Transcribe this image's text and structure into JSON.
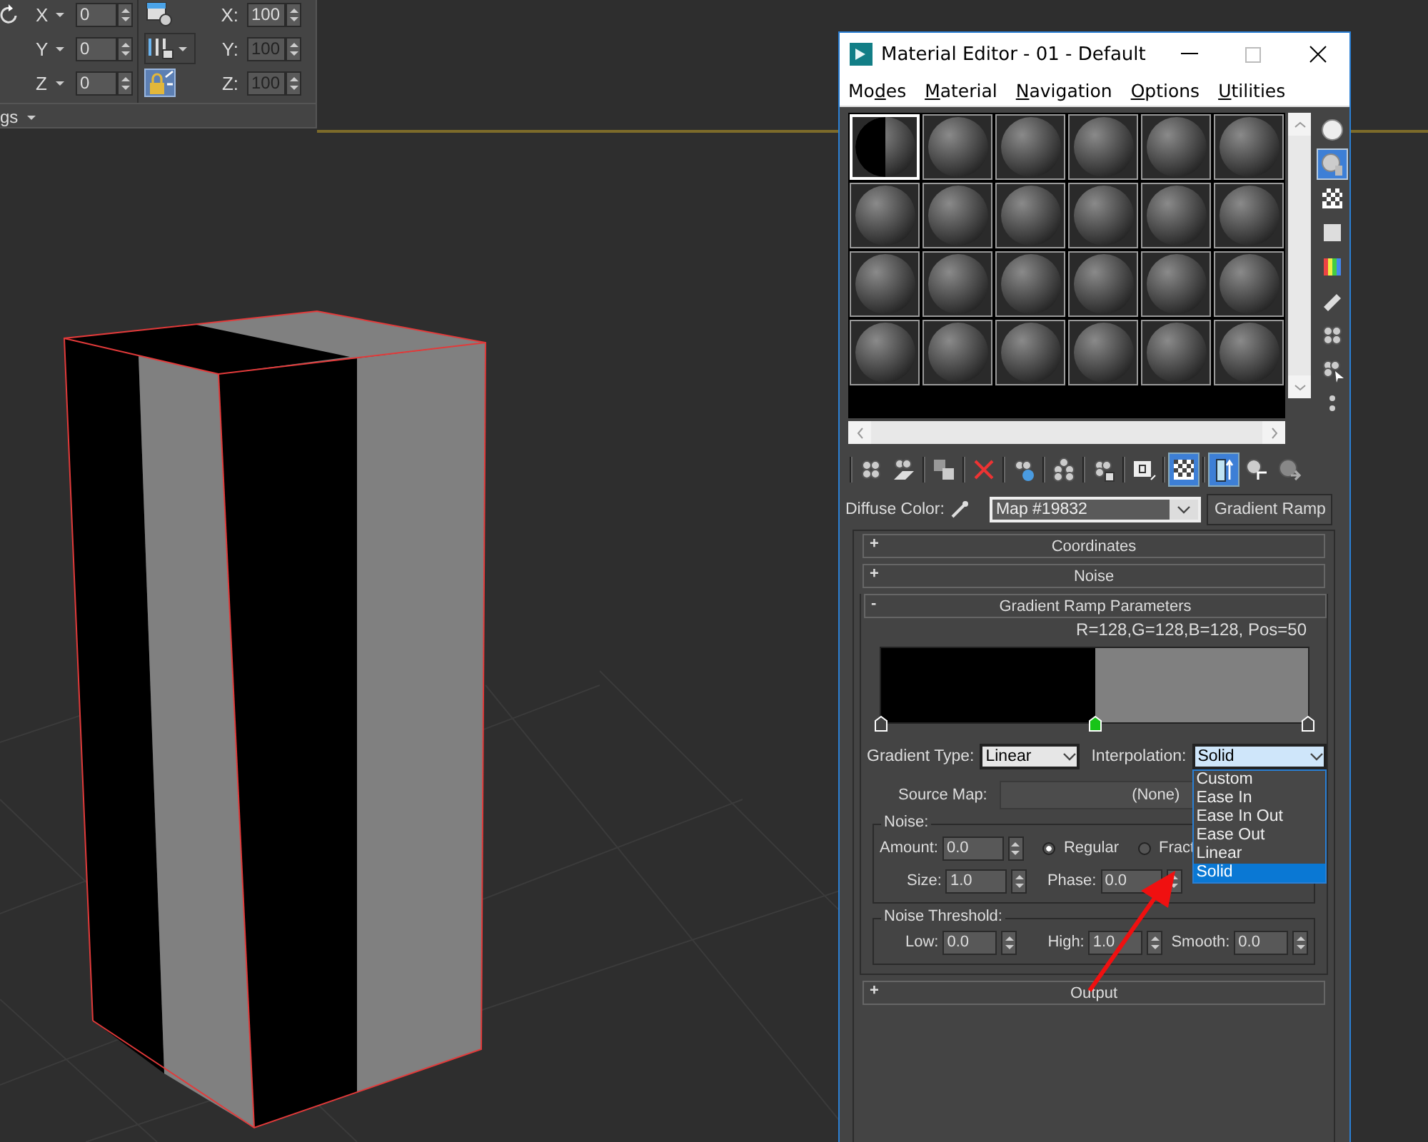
{
  "transform_panel": {
    "move_fields": [
      {
        "axis": "X",
        "value": "0"
      },
      {
        "axis": "Y",
        "value": "0"
      },
      {
        "axis": "Z",
        "value": "0"
      }
    ],
    "scale_fields": [
      {
        "axis": "X:",
        "value": "100",
        "disabled": false
      },
      {
        "axis": "Y:",
        "value": "100",
        "disabled": true
      },
      {
        "axis": "Z:",
        "value": "100",
        "disabled": true
      }
    ],
    "lock_selected": true,
    "footer": "gs"
  },
  "material_editor": {
    "title": "Material Editor - 01 - Default",
    "menu": [
      {
        "label": "Modes"
      },
      {
        "label": "Material"
      },
      {
        "label": "Navigation"
      },
      {
        "label": "Options"
      },
      {
        "label": "Utilities"
      }
    ],
    "slots": [
      {
        "kind": "split",
        "selected": true
      },
      {
        "kind": "sphere",
        "selected": false
      },
      {
        "kind": "sphere",
        "selected": false
      },
      {
        "kind": "sphere",
        "selected": false
      },
      {
        "kind": "sphere",
        "selected": false
      },
      {
        "kind": "sphere",
        "selected": false
      },
      {
        "kind": "sphere",
        "selected": false
      },
      {
        "kind": "sphere",
        "selected": false
      },
      {
        "kind": "sphere",
        "selected": false
      },
      {
        "kind": "sphere",
        "selected": false
      },
      {
        "kind": "sphere",
        "selected": false
      },
      {
        "kind": "sphere",
        "selected": false
      },
      {
        "kind": "sphere",
        "selected": false
      },
      {
        "kind": "sphere",
        "selected": false
      },
      {
        "kind": "sphere",
        "selected": false
      },
      {
        "kind": "sphere",
        "selected": false
      },
      {
        "kind": "sphere",
        "selected": false
      },
      {
        "kind": "sphere",
        "selected": false
      },
      {
        "kind": "sphere",
        "selected": false
      },
      {
        "kind": "sphere",
        "selected": false
      },
      {
        "kind": "sphere",
        "selected": false
      },
      {
        "kind": "sphere",
        "selected": false
      },
      {
        "kind": "sphere",
        "selected": false
      },
      {
        "kind": "sphere",
        "selected": false
      }
    ],
    "side_tools": [
      {
        "kind": "sphere",
        "selected": false
      },
      {
        "kind": "backlight",
        "selected": true
      },
      {
        "kind": "checker",
        "selected": false
      },
      {
        "kind": "square",
        "selected": false
      },
      {
        "kind": "color-bars",
        "selected": false
      },
      {
        "kind": "pencil",
        "selected": false
      },
      {
        "kind": "balls",
        "selected": false
      },
      {
        "kind": "balls-cursor",
        "selected": false
      },
      {
        "kind": "dots",
        "selected": false
      }
    ],
    "toolbar": [
      {
        "kind": "balls",
        "selected": false
      },
      {
        "kind": "put",
        "selected": false
      },
      {
        "kind": "copy",
        "selected": false
      },
      {
        "kind": "delete",
        "selected": false
      },
      {
        "kind": "spheres-dot",
        "selected": false
      },
      {
        "kind": "library",
        "selected": false
      },
      {
        "kind": "mtlid",
        "selected": false
      },
      {
        "kind": "map",
        "selected": false
      },
      {
        "kind": "checker",
        "selected": true
      },
      {
        "kind": "result",
        "selected": true
      },
      {
        "kind": "parent",
        "selected": false
      },
      {
        "kind": "sibling",
        "selected": false
      }
    ],
    "diffuse": {
      "label": "Diffuse Color:",
      "map": "Map #19832",
      "type": "Gradient Ramp"
    },
    "rollouts_top": [
      {
        "sign": "+",
        "title": "Coordinates"
      },
      {
        "sign": "+",
        "title": "Noise"
      }
    ],
    "gradient": {
      "sign": "-",
      "title": "Gradient Ramp Parameters",
      "readout": "R=128,G=128,B=128, Pos=50",
      "flags": [
        {
          "level": 0,
          "color": "#000000",
          "selected": false
        },
        {
          "level": 0.5,
          "color": "#808080",
          "selected": true
        },
        {
          "level": 1,
          "selected": false
        }
      ],
      "gradient_type": {
        "label": "Gradient Type:",
        "value": "Linear"
      },
      "interpolation": {
        "label": "Interpolation:",
        "value": "Solid",
        "expanded": true,
        "options": [
          {
            "label": "Custom",
            "selected": false
          },
          {
            "label": "Ease In",
            "selected": false
          },
          {
            "label": "Ease In Out",
            "selected": false
          },
          {
            "label": "Ease Out",
            "selected": false
          },
          {
            "label": "Linear",
            "selected": false
          },
          {
            "label": "Solid",
            "selected": true
          }
        ]
      },
      "source_map": {
        "label": "Source Map:",
        "value": "(None)"
      },
      "noise": {
        "title": "Noise:",
        "amount": {
          "label": "Amount:",
          "value": "0.0"
        },
        "radios": [
          {
            "label": "Regular",
            "selected": true
          },
          {
            "label": "Fract",
            "selected": false
          }
        ],
        "size": {
          "label": "Size:",
          "value": "1.0"
        },
        "phase": {
          "label": "Phase:",
          "value": "0.0"
        }
      },
      "threshold": {
        "title": "Noise Threshold:",
        "fields": [
          {
            "label": "Low:",
            "value": "0.0"
          },
          {
            "label": "High:",
            "value": "1.0"
          },
          {
            "label": "Smooth:",
            "value": "0.0"
          }
        ]
      }
    },
    "rollouts_bottom": [
      {
        "sign": "+",
        "title": "Output"
      }
    ]
  }
}
